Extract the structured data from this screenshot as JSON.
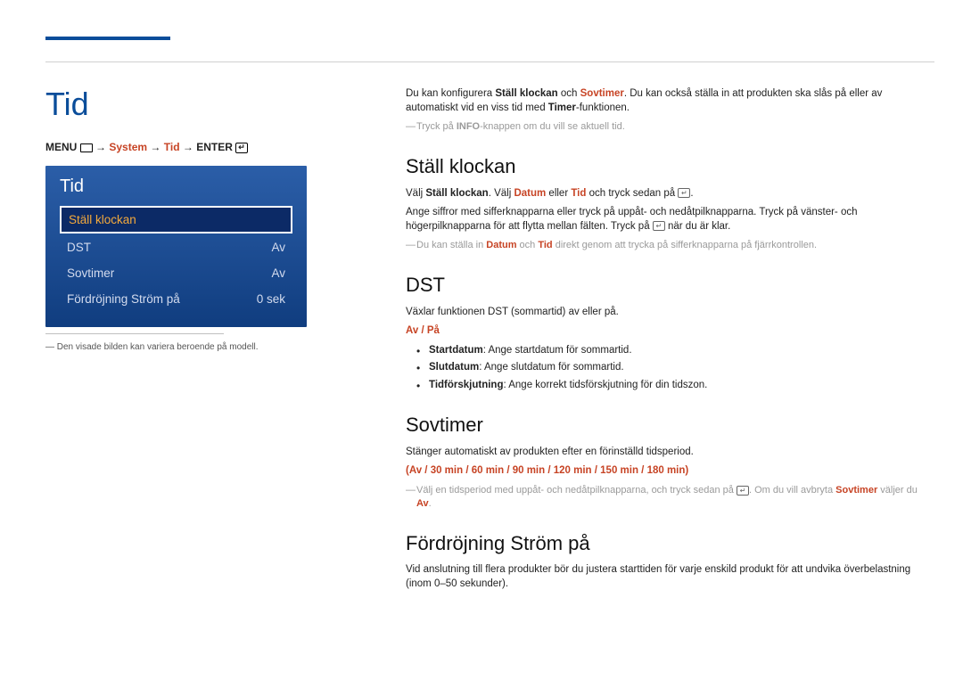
{
  "pageTitle": "Tid",
  "breadcrumb": {
    "menuLabel": "MENU",
    "arrow1": " → ",
    "system": "System",
    "arrow2": " → ",
    "tid": "Tid",
    "arrow3": " → ",
    "enter": "ENTER"
  },
  "panel": {
    "title": "Tid",
    "items": [
      {
        "label": "Ställ klockan",
        "value": "",
        "selected": true
      },
      {
        "label": "DST",
        "value": "Av",
        "selected": false
      },
      {
        "label": "Sovtimer",
        "value": "Av",
        "selected": false
      },
      {
        "label": "Fördröjning Ström på",
        "value": "0 sek",
        "selected": false
      }
    ]
  },
  "footnote": "― Den visade bilden kan variera beroende på modell.",
  "intro": {
    "p1a": "Du kan konfigurera ",
    "p1b": "Ställ klockan",
    "p1c": " och ",
    "p1d": "Sovtimer",
    "p1e": ". Du kan också ställa in att produkten ska slås på eller av automatiskt vid en viss tid med ",
    "p1f": "Timer",
    "p1g": "-funktionen.",
    "note1a": "Tryck på ",
    "note1b": "INFO",
    "note1c": "-knappen om du vill se aktuell tid."
  },
  "section1": {
    "title": "Ställ klockan",
    "p1a": "Välj ",
    "p1b": "Ställ klockan",
    "p1c": ". Välj ",
    "p1d": "Datum",
    "p1e": " eller ",
    "p1f": "Tid",
    "p1g": " och tryck sedan på ",
    "p1h": ".",
    "p2": "Ange siffror med sifferknapparna eller tryck på uppåt- och nedåtpilknapparna. Tryck på vänster- och högerpilknapparna för att flytta mellan fälten. Tryck på ",
    "p2b": " när du är klar.",
    "note1a": "Du kan ställa in ",
    "note1b": "Datum",
    "note1c": " och ",
    "note1d": "Tid",
    "note1e": " direkt genom att trycka på sifferknapparna på fjärrkontrollen."
  },
  "section2": {
    "title": "DST",
    "p1": "Växlar funktionen DST (sommartid) av eller på.",
    "toggle": "Av / På",
    "li1a": "Startdatum",
    "li1b": ": Ange startdatum för sommartid.",
    "li2a": "Slutdatum",
    "li2b": ": Ange slutdatum för sommartid.",
    "li3a": "Tidförskjutning",
    "li3b": ": Ange korrekt tidsförskjutning för din tidszon."
  },
  "section3": {
    "title": "Sovtimer",
    "p1": "Stänger automatiskt av produkten efter en förinställd tidsperiod.",
    "options": "(Av / 30 min / 60 min / 90 min / 120 min / 150 min / 180 min)",
    "note1a": "Välj en tidsperiod med uppåt- och nedåtpilknapparna, och tryck sedan på ",
    "note1b": ". Om du vill avbryta ",
    "note1c": "Sovtimer",
    "note1d": " väljer du ",
    "note1e": "Av",
    "note1f": "."
  },
  "section4": {
    "title": "Fördröjning Ström på",
    "p1": "Vid anslutning till flera produkter bör du justera starttiden för varje enskild produkt för att undvika överbelastning (inom 0–50 sekunder)."
  }
}
